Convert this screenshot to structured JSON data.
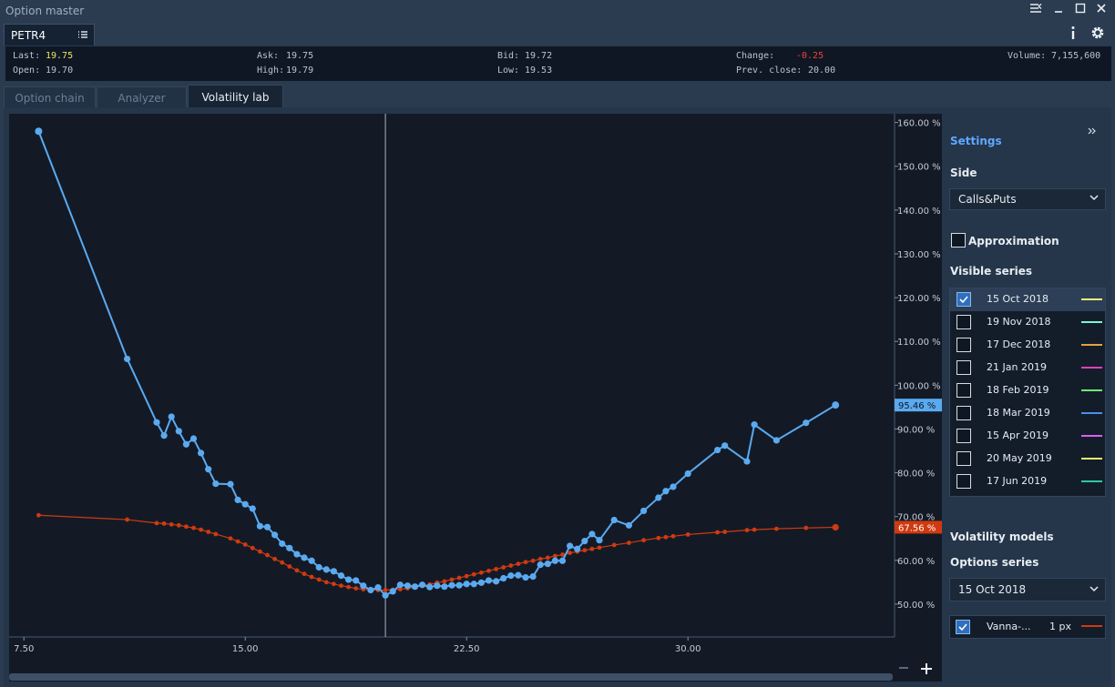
{
  "window": {
    "title": "Option master"
  },
  "symbol": {
    "tab_label": "PETR4"
  },
  "quote": {
    "last_label": "Last:",
    "last": "19.75",
    "open_label": "Open:",
    "open": "19.70",
    "ask_label": "Ask:",
    "ask": "19.75",
    "high_label": "High:",
    "high": "19.79",
    "bid_label": "Bid:",
    "bid": "19.72",
    "low_label": "Low:",
    "low": "19.53",
    "change_label": "Change:",
    "change": "-0.25",
    "prev_close_label": "Prev. close:",
    "prev_close": "20.00",
    "volume_label": "Volume:",
    "volume": "7,155,600"
  },
  "tabs": [
    {
      "label": "Option chain",
      "active": false
    },
    {
      "label": "Analyzer",
      "active": false
    },
    {
      "label": "Volatility lab",
      "active": true
    }
  ],
  "sidebar": {
    "settings_label": "Settings",
    "side_label": "Side",
    "side_value": "Calls&Puts",
    "approximation_label": "Approximation",
    "approximation_checked": false,
    "visible_series_label": "Visible series",
    "series": [
      {
        "date": "15 Oct 2018",
        "checked": true,
        "color": "#f3f07a"
      },
      {
        "date": "19 Nov 2018",
        "checked": false,
        "color": "#7ff5d6"
      },
      {
        "date": "17 Dec 2018",
        "checked": false,
        "color": "#e8a040"
      },
      {
        "date": "21 Jan 2019",
        "checked": false,
        "color": "#e040c0"
      },
      {
        "date": "18 Feb 2019",
        "checked": false,
        "color": "#70f070"
      },
      {
        "date": "18 Mar 2019",
        "checked": false,
        "color": "#4a90e8"
      },
      {
        "date": "15 Apr 2019",
        "checked": false,
        "color": "#d860f0"
      },
      {
        "date": "20 May 2019",
        "checked": false,
        "color": "#e8f070"
      },
      {
        "date": "17 Jun 2019",
        "checked": false,
        "color": "#30c8a0"
      }
    ],
    "volatility_models_label": "Volatility models",
    "options_series_label": "Options series",
    "options_series_value": "15 Oct 2018",
    "model": {
      "name": "Vanna-...",
      "width": "1 px",
      "checked": true,
      "color": "#d03a10"
    }
  },
  "chart_data": {
    "type": "line",
    "x_ticks": [
      "7.50",
      "15.00",
      "22.50",
      "30.00"
    ],
    "y_ticks": [
      "50.00 %",
      "60.00 %",
      "70.00 %",
      "80.00 %",
      "90.00 %",
      "100.00 %",
      "110.00 %",
      "120.00 %",
      "130.00 %",
      "140.00 %",
      "150.00 %",
      "160.00 %"
    ],
    "xlim": [
      7.0,
      37.0
    ],
    "ylim": [
      42.5,
      162.0
    ],
    "crosshair_x": 19.75,
    "series": [
      {
        "color": "#5aaaf0",
        "last_value_label": "95.46 %",
        "x": [
          8.0,
          11.0,
          12.0,
          12.25,
          12.5,
          12.75,
          13.0,
          13.25,
          13.5,
          13.75,
          14.0,
          14.5,
          14.75,
          15.0,
          15.25,
          15.5,
          15.75,
          16.0,
          16.25,
          16.5,
          16.75,
          17.0,
          17.25,
          17.5,
          17.75,
          18.0,
          18.25,
          18.5,
          18.75,
          19.0,
          19.25,
          19.5,
          19.75,
          20.0,
          20.25,
          20.5,
          20.75,
          21.0,
          21.25,
          21.5,
          21.75,
          22.0,
          22.25,
          22.5,
          22.75,
          23.0,
          23.25,
          23.5,
          23.75,
          24.0,
          24.25,
          24.5,
          24.75,
          25.0,
          25.25,
          25.5,
          25.75,
          26.0,
          26.25,
          26.5,
          26.75,
          27.0,
          27.5,
          28.0,
          28.5,
          29.0,
          29.25,
          29.5,
          30.0,
          31.0,
          31.25,
          32.0,
          32.25,
          33.0,
          34.0,
          35.0
        ],
        "values": [
          158.0,
          106.0,
          91.5,
          88.5,
          92.8,
          89.5,
          86.5,
          87.8,
          84.5,
          80.8,
          77.5,
          77.4,
          73.8,
          72.8,
          71.8,
          67.8,
          67.6,
          65.8,
          63.8,
          62.8,
          61.4,
          60.6,
          59.9,
          58.4,
          57.9,
          57.5,
          56.5,
          55.6,
          55.4,
          54.2,
          53.2,
          53.8,
          52.0,
          52.9,
          54.4,
          54.2,
          54.0,
          54.4,
          53.9,
          54.2,
          54.0,
          54.3,
          54.3,
          54.6,
          54.6,
          54.9,
          55.4,
          55.2,
          55.9,
          56.5,
          56.6,
          56.1,
          56.3,
          59.0,
          59.2,
          59.9,
          59.9,
          63.3,
          62.6,
          64.4,
          66.0,
          64.6,
          69.2,
          68.0,
          71.3,
          74.3,
          75.8,
          76.8,
          79.8,
          85.2,
          86.2,
          82.6,
          91.0,
          87.4,
          91.4,
          95.46
        ]
      },
      {
        "color": "#d03a10",
        "last_value_label": "67.56 %",
        "x": [
          8.0,
          11.0,
          12.0,
          12.25,
          12.5,
          12.75,
          13.0,
          13.25,
          13.5,
          13.75,
          14.0,
          14.5,
          14.75,
          15.0,
          15.25,
          15.5,
          15.75,
          16.0,
          16.25,
          16.5,
          16.75,
          17.0,
          17.25,
          17.5,
          17.75,
          18.0,
          18.25,
          18.5,
          18.75,
          19.0,
          19.25,
          19.5,
          19.75,
          20.0,
          20.25,
          20.5,
          20.75,
          21.0,
          21.25,
          21.5,
          21.75,
          22.0,
          22.25,
          22.5,
          22.75,
          23.0,
          23.25,
          23.5,
          23.75,
          24.0,
          24.25,
          24.5,
          24.75,
          25.0,
          25.25,
          25.5,
          25.75,
          26.0,
          26.25,
          26.5,
          26.75,
          27.0,
          27.5,
          28.0,
          28.5,
          29.0,
          29.25,
          29.5,
          30.0,
          31.0,
          31.25,
          32.0,
          32.25,
          33.0,
          34.0,
          35.0
        ],
        "values": [
          70.3,
          69.3,
          68.5,
          68.4,
          68.2,
          68.0,
          67.7,
          67.4,
          67.0,
          66.5,
          66.0,
          65.0,
          64.3,
          63.6,
          62.8,
          62.0,
          61.2,
          60.3,
          59.5,
          58.6,
          57.7,
          56.9,
          56.2,
          55.6,
          55.0,
          54.6,
          54.2,
          53.9,
          53.6,
          53.4,
          53.3,
          53.2,
          53.2,
          53.3,
          53.4,
          53.6,
          53.9,
          54.2,
          54.5,
          54.9,
          55.2,
          55.6,
          56.0,
          56.4,
          56.8,
          57.2,
          57.6,
          58.0,
          58.4,
          58.8,
          59.2,
          59.6,
          59.9,
          60.3,
          60.6,
          61.0,
          61.3,
          61.7,
          62.0,
          62.3,
          62.6,
          62.9,
          63.5,
          64.0,
          64.6,
          65.1,
          65.3,
          65.5,
          65.9,
          66.4,
          66.5,
          66.9,
          67.0,
          67.2,
          67.4,
          67.56
        ]
      }
    ]
  }
}
